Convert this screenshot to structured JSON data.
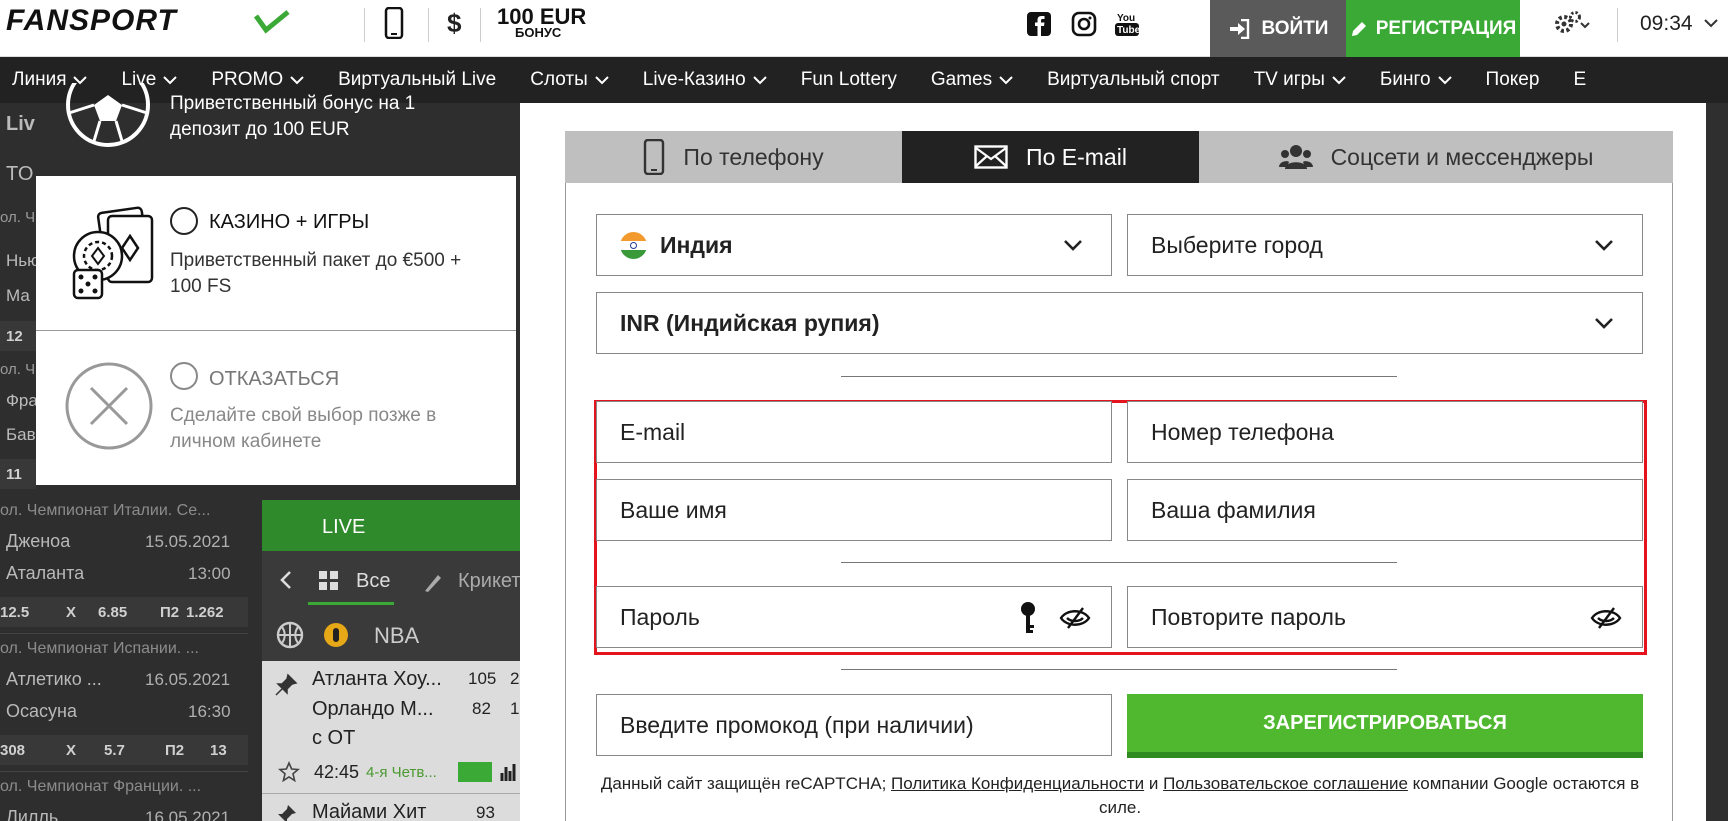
{
  "header": {
    "logo": "FANSPORT",
    "currency_symbol": "$",
    "bonus_amount": "100 EUR",
    "bonus_label": "БОНУС",
    "login_label": "ВОЙТИ",
    "register_label": "РЕГИСТРАЦИЯ",
    "time": "09:34",
    "accent": "#3aa935"
  },
  "nav": {
    "items": [
      {
        "label": "Линия",
        "chevron": true
      },
      {
        "label": "Live",
        "chevron": true
      },
      {
        "label": "PROMO",
        "chevron": true
      },
      {
        "label": "Виртуальный Live",
        "chevron": false
      },
      {
        "label": "Слоты",
        "chevron": true
      },
      {
        "label": "Live-Казино",
        "chevron": true
      },
      {
        "label": "Fun Lottery",
        "chevron": false
      },
      {
        "label": "Games",
        "chevron": true
      },
      {
        "label": "Виртуальный спорт",
        "chevron": false
      },
      {
        "label": "TV игры",
        "chevron": true
      },
      {
        "label": "Бинго",
        "chevron": true
      },
      {
        "label": "Покер",
        "chevron": false
      },
      {
        "label": "Е",
        "chevron": false
      }
    ]
  },
  "background": {
    "left_fragments": [
      "Liv",
      "TO",
      "ол. Ч",
      "Нью",
      "Ма",
      "12",
      "ол. Ч",
      "Фра",
      "Бав",
      "11"
    ],
    "matches": [
      {
        "league": "ол. Чемпионат Италии. Се...",
        "team1": "Дженоа",
        "team2": "Аталанта",
        "date": "15.05.2021",
        "time": "13:00",
        "odds": [
          "12.5",
          "X",
          "6.85",
          "П2",
          "1.262"
        ]
      },
      {
        "league": "ол. Чемпионат Испании. ...",
        "team1": "Атлетико ...",
        "team2": "Осасуна",
        "date": "16.05.2021",
        "time": "16:30",
        "odds": [
          "308",
          "X",
          "5.7",
          "П2",
          "13"
        ]
      },
      {
        "league": "ол. Чемпионат Франции. ...",
        "team1": "Лилль",
        "team2": "",
        "date": "16.05.2021",
        "time": "",
        "odds": []
      }
    ],
    "live_label": "LIVE",
    "filter_all": "Все",
    "filter_cricket": "Крикет",
    "nba_label": "NBA",
    "nba_game": {
      "team1": "Атланта Хоу...",
      "team2": "Орландо М...",
      "note": "с ОТ",
      "score1": "105",
      "score1b": "2",
      "score2": "82",
      "score2b": "1",
      "clock": "42:45",
      "period": "4-я Четв..."
    },
    "nba_next": {
      "team1": "Майами Хит",
      "score": "93"
    }
  },
  "bonus_popup": {
    "welcome_text": "Приветственный бонус на 1 депозит до 100 EUR",
    "casino": {
      "title": "КАЗИНО + ИГРЫ",
      "desc": "Приветственный пакет до €500 + 100 FS"
    },
    "decline": {
      "title": "ОТКАЗАТЬСЯ",
      "desc": "Сделайте свой выбор позже в личном кабинете"
    }
  },
  "registration": {
    "tabs": [
      {
        "label": "По телефону",
        "active": false
      },
      {
        "label": "По E-mail",
        "active": true
      },
      {
        "label": "Соцсети и мессенджеры",
        "active": false
      }
    ],
    "country": "Индия",
    "city_placeholder": "Выберите город",
    "currency": "INR (Индийская рупия)",
    "email_placeholder": "E-mail",
    "phone_placeholder": "Номер телефона",
    "first_name_placeholder": "Ваше имя",
    "last_name_placeholder": "Ваша фамилия",
    "password_placeholder": "Пароль",
    "password_repeat_placeholder": "Повторите пароль",
    "promo_placeholder": "Введите промокод (при наличии)",
    "submit_label": "ЗАРЕГИСТРИРОВАТЬСЯ",
    "highlight_color": "#e3141e"
  },
  "legal": {
    "text_before": "Данный сайт защищён reCAPTCHA; ",
    "privacy_link": "Политика Конфиденциальности",
    "and": " и ",
    "terms_link": "Пользовательское соглашение",
    "text_after": " компании Google остаются в силе."
  }
}
